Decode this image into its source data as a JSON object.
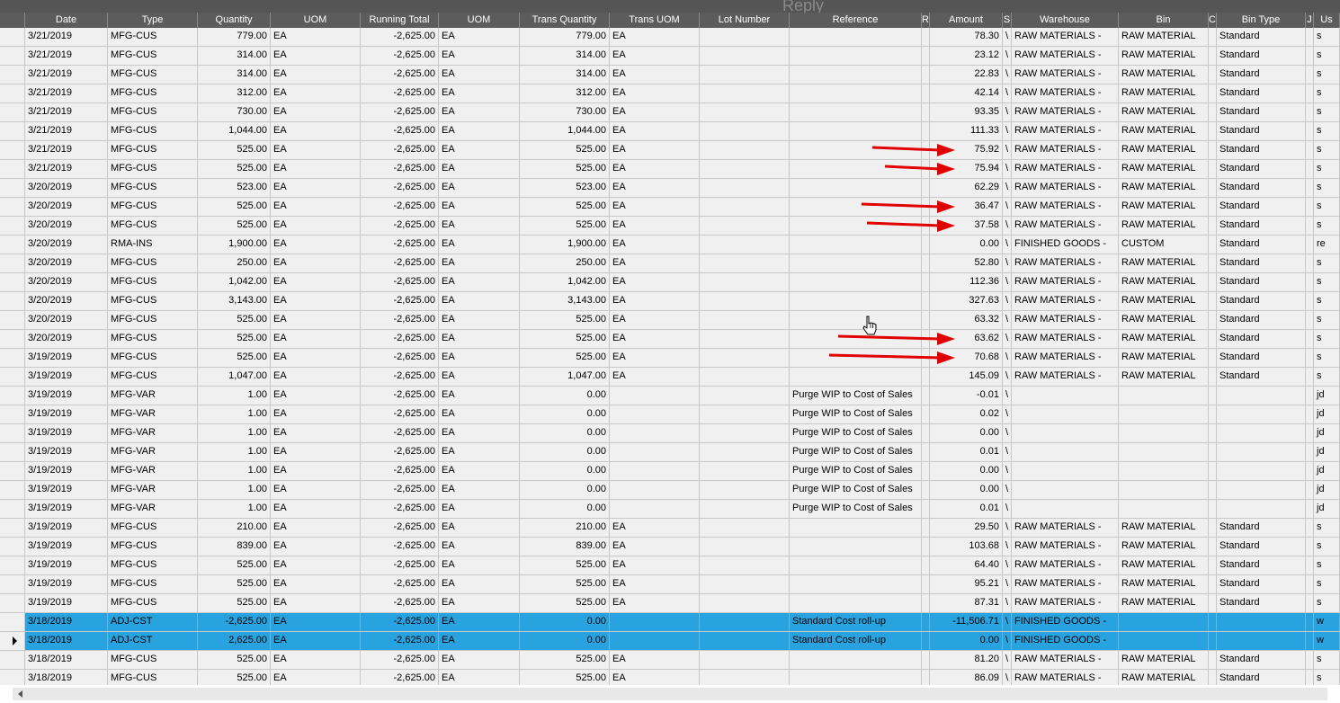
{
  "header": {
    "columns": [
      "Date",
      "Type",
      "Quantity",
      "UOM",
      "Running Total",
      "UOM",
      "Trans Quantity",
      "Trans UOM",
      "Lot Number",
      "Reference",
      "R",
      "Amount",
      "S",
      "Warehouse",
      "Bin",
      "C",
      "Bin Type",
      "J",
      "Us"
    ],
    "background_text": "Reply"
  },
  "rows": [
    {
      "date": "3/21/2019",
      "type": "MFG-CUS",
      "qty": "779.00",
      "uom": "EA",
      "running": "-2,625.00",
      "uom2": "EA",
      "tqty": "779.00",
      "tuom": "EA",
      "lot": "",
      "ref": "",
      "r": "",
      "amount": "78.30",
      "s": "\\",
      "warehouse": "RAW MATERIALS -",
      "bin": "RAW MATERIAL",
      "c": "",
      "bintype": "Standard",
      "j": "",
      "us": "s"
    },
    {
      "date": "3/21/2019",
      "type": "MFG-CUS",
      "qty": "314.00",
      "uom": "EA",
      "running": "-2,625.00",
      "uom2": "EA",
      "tqty": "314.00",
      "tuom": "EA",
      "lot": "",
      "ref": "",
      "r": "",
      "amount": "23.12",
      "s": "\\",
      "warehouse": "RAW MATERIALS -",
      "bin": "RAW MATERIAL",
      "c": "",
      "bintype": "Standard",
      "j": "",
      "us": "s"
    },
    {
      "date": "3/21/2019",
      "type": "MFG-CUS",
      "qty": "314.00",
      "uom": "EA",
      "running": "-2,625.00",
      "uom2": "EA",
      "tqty": "314.00",
      "tuom": "EA",
      "lot": "",
      "ref": "",
      "r": "",
      "amount": "22.83",
      "s": "\\",
      "warehouse": "RAW MATERIALS -",
      "bin": "RAW MATERIAL",
      "c": "",
      "bintype": "Standard",
      "j": "",
      "us": "s"
    },
    {
      "date": "3/21/2019",
      "type": "MFG-CUS",
      "qty": "312.00",
      "uom": "EA",
      "running": "-2,625.00",
      "uom2": "EA",
      "tqty": "312.00",
      "tuom": "EA",
      "lot": "",
      "ref": "",
      "r": "",
      "amount": "42.14",
      "s": "\\",
      "warehouse": "RAW MATERIALS -",
      "bin": "RAW MATERIAL",
      "c": "",
      "bintype": "Standard",
      "j": "",
      "us": "s"
    },
    {
      "date": "3/21/2019",
      "type": "MFG-CUS",
      "qty": "730.00",
      "uom": "EA",
      "running": "-2,625.00",
      "uom2": "EA",
      "tqty": "730.00",
      "tuom": "EA",
      "lot": "",
      "ref": "",
      "r": "",
      "amount": "93.35",
      "s": "\\",
      "warehouse": "RAW MATERIALS -",
      "bin": "RAW MATERIAL",
      "c": "",
      "bintype": "Standard",
      "j": "",
      "us": "s"
    },
    {
      "date": "3/21/2019",
      "type": "MFG-CUS",
      "qty": "1,044.00",
      "uom": "EA",
      "running": "-2,625.00",
      "uom2": "EA",
      "tqty": "1,044.00",
      "tuom": "EA",
      "lot": "",
      "ref": "",
      "r": "",
      "amount": "111.33",
      "s": "\\",
      "warehouse": "RAW MATERIALS -",
      "bin": "RAW MATERIAL",
      "c": "",
      "bintype": "Standard",
      "j": "",
      "us": "s"
    },
    {
      "date": "3/21/2019",
      "type": "MFG-CUS",
      "qty": "525.00",
      "uom": "EA",
      "running": "-2,625.00",
      "uom2": "EA",
      "tqty": "525.00",
      "tuom": "EA",
      "lot": "",
      "ref": "",
      "r": "",
      "amount": "75.92",
      "s": "\\",
      "warehouse": "RAW MATERIALS -",
      "bin": "RAW MATERIAL",
      "c": "",
      "bintype": "Standard",
      "j": "",
      "us": "s"
    },
    {
      "date": "3/21/2019",
      "type": "MFG-CUS",
      "qty": "525.00",
      "uom": "EA",
      "running": "-2,625.00",
      "uom2": "EA",
      "tqty": "525.00",
      "tuom": "EA",
      "lot": "",
      "ref": "",
      "r": "",
      "amount": "75.94",
      "s": "\\",
      "warehouse": "RAW MATERIALS -",
      "bin": "RAW MATERIAL",
      "c": "",
      "bintype": "Standard",
      "j": "",
      "us": "s"
    },
    {
      "date": "3/20/2019",
      "type": "MFG-CUS",
      "qty": "523.00",
      "uom": "EA",
      "running": "-2,625.00",
      "uom2": "EA",
      "tqty": "523.00",
      "tuom": "EA",
      "lot": "",
      "ref": "",
      "r": "",
      "amount": "62.29",
      "s": "\\",
      "warehouse": "RAW MATERIALS -",
      "bin": "RAW MATERIAL",
      "c": "",
      "bintype": "Standard",
      "j": "",
      "us": "s"
    },
    {
      "date": "3/20/2019",
      "type": "MFG-CUS",
      "qty": "525.00",
      "uom": "EA",
      "running": "-2,625.00",
      "uom2": "EA",
      "tqty": "525.00",
      "tuom": "EA",
      "lot": "",
      "ref": "",
      "r": "",
      "amount": "36.47",
      "s": "\\",
      "warehouse": "RAW MATERIALS -",
      "bin": "RAW MATERIAL",
      "c": "",
      "bintype": "Standard",
      "j": "",
      "us": "s"
    },
    {
      "date": "3/20/2019",
      "type": "MFG-CUS",
      "qty": "525.00",
      "uom": "EA",
      "running": "-2,625.00",
      "uom2": "EA",
      "tqty": "525.00",
      "tuom": "EA",
      "lot": "",
      "ref": "",
      "r": "",
      "amount": "37.58",
      "s": "\\",
      "warehouse": "RAW MATERIALS -",
      "bin": "RAW MATERIAL",
      "c": "",
      "bintype": "Standard",
      "j": "",
      "us": "s"
    },
    {
      "date": "3/20/2019",
      "type": "RMA-INS",
      "qty": "1,900.00",
      "uom": "EA",
      "running": "-2,625.00",
      "uom2": "EA",
      "tqty": "1,900.00",
      "tuom": "EA",
      "lot": "",
      "ref": "",
      "r": "",
      "amount": "0.00",
      "s": "\\",
      "warehouse": "FINISHED GOODS -",
      "bin": "CUSTOM",
      "c": "",
      "bintype": "Standard",
      "j": "",
      "us": "re"
    },
    {
      "date": "3/20/2019",
      "type": "MFG-CUS",
      "qty": "250.00",
      "uom": "EA",
      "running": "-2,625.00",
      "uom2": "EA",
      "tqty": "250.00",
      "tuom": "EA",
      "lot": "",
      "ref": "",
      "r": "",
      "amount": "52.80",
      "s": "\\",
      "warehouse": "RAW MATERIALS -",
      "bin": "RAW MATERIAL",
      "c": "",
      "bintype": "Standard",
      "j": "",
      "us": "s"
    },
    {
      "date": "3/20/2019",
      "type": "MFG-CUS",
      "qty": "1,042.00",
      "uom": "EA",
      "running": "-2,625.00",
      "uom2": "EA",
      "tqty": "1,042.00",
      "tuom": "EA",
      "lot": "",
      "ref": "",
      "r": "",
      "amount": "112.36",
      "s": "\\",
      "warehouse": "RAW MATERIALS -",
      "bin": "RAW MATERIAL",
      "c": "",
      "bintype": "Standard",
      "j": "",
      "us": "s"
    },
    {
      "date": "3/20/2019",
      "type": "MFG-CUS",
      "qty": "3,143.00",
      "uom": "EA",
      "running": "-2,625.00",
      "uom2": "EA",
      "tqty": "3,143.00",
      "tuom": "EA",
      "lot": "",
      "ref": "",
      "r": "",
      "amount": "327.63",
      "s": "\\",
      "warehouse": "RAW MATERIALS -",
      "bin": "RAW MATERIAL",
      "c": "",
      "bintype": "Standard",
      "j": "",
      "us": "s"
    },
    {
      "date": "3/20/2019",
      "type": "MFG-CUS",
      "qty": "525.00",
      "uom": "EA",
      "running": "-2,625.00",
      "uom2": "EA",
      "tqty": "525.00",
      "tuom": "EA",
      "lot": "",
      "ref": "",
      "r": "",
      "amount": "63.32",
      "s": "\\",
      "warehouse": "RAW MATERIALS -",
      "bin": "RAW MATERIAL",
      "c": "",
      "bintype": "Standard",
      "j": "",
      "us": "s"
    },
    {
      "date": "3/20/2019",
      "type": "MFG-CUS",
      "qty": "525.00",
      "uom": "EA",
      "running": "-2,625.00",
      "uom2": "EA",
      "tqty": "525.00",
      "tuom": "EA",
      "lot": "",
      "ref": "",
      "r": "",
      "amount": "63.62",
      "s": "\\",
      "warehouse": "RAW MATERIALS -",
      "bin": "RAW MATERIAL",
      "c": "",
      "bintype": "Standard",
      "j": "",
      "us": "s"
    },
    {
      "date": "3/19/2019",
      "type": "MFG-CUS",
      "qty": "525.00",
      "uom": "EA",
      "running": "-2,625.00",
      "uom2": "EA",
      "tqty": "525.00",
      "tuom": "EA",
      "lot": "",
      "ref": "",
      "r": "",
      "amount": "70.68",
      "s": "\\",
      "warehouse": "RAW MATERIALS -",
      "bin": "RAW MATERIAL",
      "c": "",
      "bintype": "Standard",
      "j": "",
      "us": "s"
    },
    {
      "date": "3/19/2019",
      "type": "MFG-CUS",
      "qty": "1,047.00",
      "uom": "EA",
      "running": "-2,625.00",
      "uom2": "EA",
      "tqty": "1,047.00",
      "tuom": "EA",
      "lot": "",
      "ref": "",
      "r": "",
      "amount": "145.09",
      "s": "\\",
      "warehouse": "RAW MATERIALS -",
      "bin": "RAW MATERIAL",
      "c": "",
      "bintype": "Standard",
      "j": "",
      "us": "s"
    },
    {
      "date": "3/19/2019",
      "type": "MFG-VAR",
      "qty": "1.00",
      "uom": "EA",
      "running": "-2,625.00",
      "uom2": "EA",
      "tqty": "0.00",
      "tuom": "",
      "lot": "",
      "ref": "Purge WIP to Cost of Sales",
      "r": "",
      "amount": "-0.01",
      "s": "\\",
      "warehouse": "",
      "bin": "",
      "c": "",
      "bintype": "",
      "j": "",
      "us": "jd"
    },
    {
      "date": "3/19/2019",
      "type": "MFG-VAR",
      "qty": "1.00",
      "uom": "EA",
      "running": "-2,625.00",
      "uom2": "EA",
      "tqty": "0.00",
      "tuom": "",
      "lot": "",
      "ref": "Purge WIP to Cost of Sales",
      "r": "",
      "amount": "0.02",
      "s": "\\",
      "warehouse": "",
      "bin": "",
      "c": "",
      "bintype": "",
      "j": "",
      "us": "jd"
    },
    {
      "date": "3/19/2019",
      "type": "MFG-VAR",
      "qty": "1.00",
      "uom": "EA",
      "running": "-2,625.00",
      "uom2": "EA",
      "tqty": "0.00",
      "tuom": "",
      "lot": "",
      "ref": "Purge WIP to Cost of Sales",
      "r": "",
      "amount": "0.00",
      "s": "\\",
      "warehouse": "",
      "bin": "",
      "c": "",
      "bintype": "",
      "j": "",
      "us": "jd"
    },
    {
      "date": "3/19/2019",
      "type": "MFG-VAR",
      "qty": "1.00",
      "uom": "EA",
      "running": "-2,625.00",
      "uom2": "EA",
      "tqty": "0.00",
      "tuom": "",
      "lot": "",
      "ref": "Purge WIP to Cost of Sales",
      "r": "",
      "amount": "0.01",
      "s": "\\",
      "warehouse": "",
      "bin": "",
      "c": "",
      "bintype": "",
      "j": "",
      "us": "jd"
    },
    {
      "date": "3/19/2019",
      "type": "MFG-VAR",
      "qty": "1.00",
      "uom": "EA",
      "running": "-2,625.00",
      "uom2": "EA",
      "tqty": "0.00",
      "tuom": "",
      "lot": "",
      "ref": "Purge WIP to Cost of Sales",
      "r": "",
      "amount": "0.00",
      "s": "\\",
      "warehouse": "",
      "bin": "",
      "c": "",
      "bintype": "",
      "j": "",
      "us": "jd"
    },
    {
      "date": "3/19/2019",
      "type": "MFG-VAR",
      "qty": "1.00",
      "uom": "EA",
      "running": "-2,625.00",
      "uom2": "EA",
      "tqty": "0.00",
      "tuom": "",
      "lot": "",
      "ref": "Purge WIP to Cost of Sales",
      "r": "",
      "amount": "0.00",
      "s": "\\",
      "warehouse": "",
      "bin": "",
      "c": "",
      "bintype": "",
      "j": "",
      "us": "jd"
    },
    {
      "date": "3/19/2019",
      "type": "MFG-VAR",
      "qty": "1.00",
      "uom": "EA",
      "running": "-2,625.00",
      "uom2": "EA",
      "tqty": "0.00",
      "tuom": "",
      "lot": "",
      "ref": "Purge WIP to Cost of Sales",
      "r": "",
      "amount": "0.01",
      "s": "\\",
      "warehouse": "",
      "bin": "",
      "c": "",
      "bintype": "",
      "j": "",
      "us": "jd"
    },
    {
      "date": "3/19/2019",
      "type": "MFG-CUS",
      "qty": "210.00",
      "uom": "EA",
      "running": "-2,625.00",
      "uom2": "EA",
      "tqty": "210.00",
      "tuom": "EA",
      "lot": "",
      "ref": "",
      "r": "",
      "amount": "29.50",
      "s": "\\",
      "warehouse": "RAW MATERIALS -",
      "bin": "RAW MATERIAL",
      "c": "",
      "bintype": "Standard",
      "j": "",
      "us": "s"
    },
    {
      "date": "3/19/2019",
      "type": "MFG-CUS",
      "qty": "839.00",
      "uom": "EA",
      "running": "-2,625.00",
      "uom2": "EA",
      "tqty": "839.00",
      "tuom": "EA",
      "lot": "",
      "ref": "",
      "r": "",
      "amount": "103.68",
      "s": "\\",
      "warehouse": "RAW MATERIALS -",
      "bin": "RAW MATERIAL",
      "c": "",
      "bintype": "Standard",
      "j": "",
      "us": "s"
    },
    {
      "date": "3/19/2019",
      "type": "MFG-CUS",
      "qty": "525.00",
      "uom": "EA",
      "running": "-2,625.00",
      "uom2": "EA",
      "tqty": "525.00",
      "tuom": "EA",
      "lot": "",
      "ref": "",
      "r": "",
      "amount": "64.40",
      "s": "\\",
      "warehouse": "RAW MATERIALS -",
      "bin": "RAW MATERIAL",
      "c": "",
      "bintype": "Standard",
      "j": "",
      "us": "s"
    },
    {
      "date": "3/19/2019",
      "type": "MFG-CUS",
      "qty": "525.00",
      "uom": "EA",
      "running": "-2,625.00",
      "uom2": "EA",
      "tqty": "525.00",
      "tuom": "EA",
      "lot": "",
      "ref": "",
      "r": "",
      "amount": "95.21",
      "s": "\\",
      "warehouse": "RAW MATERIALS -",
      "bin": "RAW MATERIAL",
      "c": "",
      "bintype": "Standard",
      "j": "",
      "us": "s"
    },
    {
      "date": "3/19/2019",
      "type": "MFG-CUS",
      "qty": "525.00",
      "uom": "EA",
      "running": "-2,625.00",
      "uom2": "EA",
      "tqty": "525.00",
      "tuom": "EA",
      "lot": "",
      "ref": "",
      "r": "",
      "amount": "87.31",
      "s": "\\",
      "warehouse": "RAW MATERIALS -",
      "bin": "RAW MATERIAL",
      "c": "",
      "bintype": "Standard",
      "j": "",
      "us": "s"
    },
    {
      "date": "3/18/2019",
      "type": "ADJ-CST",
      "qty": "-2,625.00",
      "uom": "EA",
      "running": "-2,625.00",
      "uom2": "EA",
      "tqty": "0.00",
      "tuom": "",
      "lot": "",
      "ref": "Standard Cost roll-up",
      "r": "",
      "amount": "-11,506.71",
      "s": "\\",
      "warehouse": "FINISHED GOODS -",
      "bin": "",
      "c": "",
      "bintype": "",
      "j": "",
      "us": "w",
      "selected": true
    },
    {
      "date": "3/18/2019",
      "type": "ADJ-CST",
      "qty": "2,625.00",
      "uom": "EA",
      "running": "-2,625.00",
      "uom2": "EA",
      "tqty": "0.00",
      "tuom": "",
      "lot": "",
      "ref": "Standard Cost roll-up",
      "r": "",
      "amount": "0.00",
      "s": "\\",
      "warehouse": "FINISHED GOODS -",
      "bin": "",
      "c": "",
      "bintype": "",
      "j": "",
      "us": "w",
      "selected": true,
      "current": true
    },
    {
      "date": "3/18/2019",
      "type": "MFG-CUS",
      "qty": "525.00",
      "uom": "EA",
      "running": "-2,625.00",
      "uom2": "EA",
      "tqty": "525.00",
      "tuom": "EA",
      "lot": "",
      "ref": "",
      "r": "",
      "amount": "81.20",
      "s": "\\",
      "warehouse": "RAW MATERIALS -",
      "bin": "RAW MATERIAL",
      "c": "",
      "bintype": "Standard",
      "j": "",
      "us": "s"
    },
    {
      "date": "3/18/2019",
      "type": "MFG-CUS",
      "qty": "525.00",
      "uom": "EA",
      "running": "-2,625.00",
      "uom2": "EA",
      "tqty": "525.00",
      "tuom": "EA",
      "lot": "",
      "ref": "",
      "r": "",
      "amount": "86.09",
      "s": "\\",
      "warehouse": "RAW MATERIALS -",
      "bin": "RAW MATERIAL",
      "c": "",
      "bintype": "Standard",
      "j": "",
      "us": "s"
    }
  ],
  "annotation_rows": [
    6,
    7,
    9,
    10,
    16,
    17
  ],
  "colors": {
    "header_bg": "#5c5c5c",
    "row_bg": "#f0f0f0",
    "selected_bg": "#29a3e0",
    "annotation_arrow": "#e00000"
  },
  "icons": {
    "row_pointer": "row-pointer-icon",
    "cursor": "hand-cursor-icon",
    "annotation": "red-arrow-icon"
  }
}
